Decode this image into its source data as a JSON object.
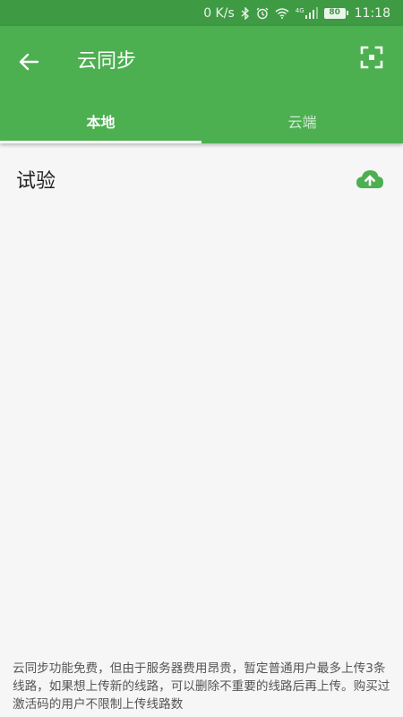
{
  "status_bar": {
    "net_speed": "0 K/s",
    "network_type": "4G",
    "battery": "80",
    "time": "11:18",
    "icons": [
      "bluetooth-icon",
      "alarm-icon",
      "wifi-icon",
      "signal-icon",
      "battery-icon"
    ]
  },
  "app_bar": {
    "title": "云同步",
    "back_icon": "arrow-left-icon",
    "scan_icon": "scan-frame-icon",
    "color": "#4caf50"
  },
  "tabs": [
    {
      "label": "本地",
      "active": true
    },
    {
      "label": "云端",
      "active": false
    }
  ],
  "list": {
    "items": [
      {
        "label": "试验",
        "action_icon": "cloud-upload-icon"
      }
    ]
  },
  "footer": {
    "note": "云同步功能免费，但由于服务器费用昂贵，暂定普通用户最多上传3条线路，如果想上传新的线路，可以删除不重要的线路后再上传。购买过激活码的用户不限制上传线路数"
  },
  "colors": {
    "accent": "#4caf50",
    "status_bar": "#3f9a44",
    "background": "#f6f6f6"
  }
}
